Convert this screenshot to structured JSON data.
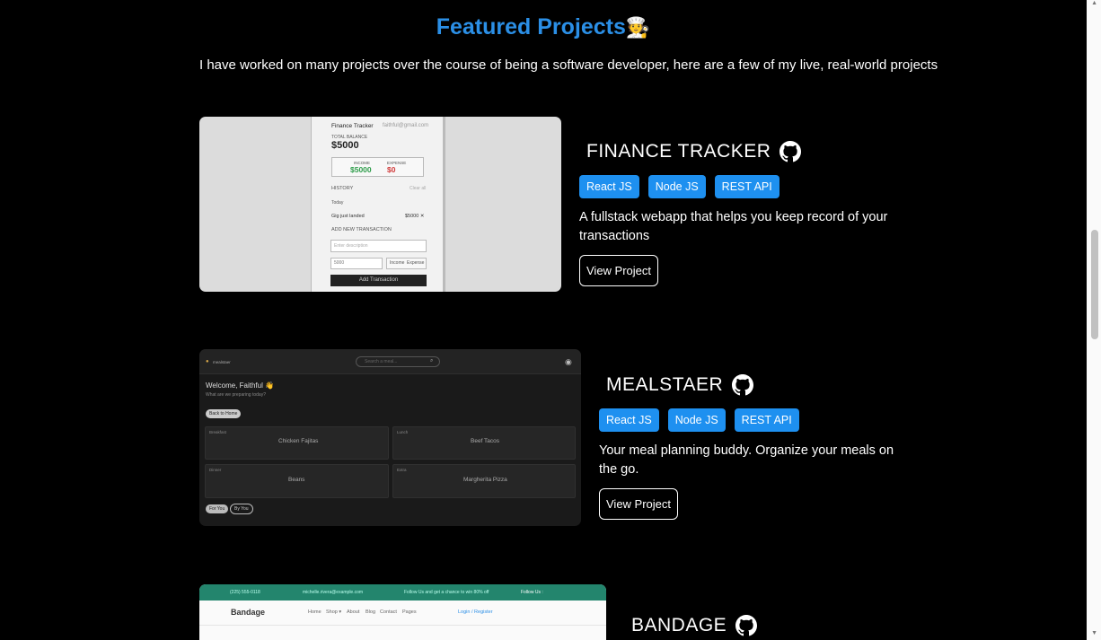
{
  "section": {
    "title": "Featured Projects",
    "title_emoji": "🧑‍🍳",
    "intro": "I have worked on many projects over the course of being a software developer, here are a few of my live, real-world projects"
  },
  "projects": [
    {
      "name": "FINANCE TRACKER",
      "tags": [
        "React JS",
        "Node JS",
        "REST API"
      ],
      "description": "A fullstack webapp that helps you keep record of your transactions",
      "button": "View Project",
      "screenshot": {
        "app_title": "Finance Tracker",
        "email": "faithful@gmail.com",
        "balance_label": "TOTAL BALANCE",
        "balance": "$5000",
        "income_label": "INCOME",
        "income": "$5000",
        "expense_label": "EXPENSE",
        "expense": "$0",
        "history_label": "HISTORY",
        "history_link": "Clear all",
        "today_label": "Today",
        "item_name": "Gig just landed",
        "item_amount": "$5000 ✕",
        "add_label": "ADD NEW TRANSACTION",
        "desc_placeholder": "Enter description",
        "amount_value": "5000",
        "income_btn": "Income",
        "expense_btn": "Expense",
        "submit": "Add Transaction"
      }
    },
    {
      "name": "MEALSTAER",
      "tags": [
        "React JS",
        "Node JS",
        "REST API"
      ],
      "description": "Your meal planning buddy. Organize your meals on the go.",
      "button": "View Project",
      "screenshot": {
        "logo": "mealstaer",
        "search_placeholder": "Search a meal...",
        "welcome": "Welcome, Faithful 👋",
        "subtitle": "What are we preparing today?",
        "pill": "Back to Home",
        "meals": [
          {
            "type": "Breakfast",
            "name": "Chicken Fajitas"
          },
          {
            "type": "Lunch",
            "name": "Beef Tacos"
          },
          {
            "type": "Dinner",
            "name": "Beans"
          },
          {
            "type": "Extra",
            "name": "Margherita Pizza"
          }
        ],
        "btn1": "For You",
        "btn2": "By You"
      }
    },
    {
      "name": "BANDAGE",
      "screenshot": {
        "phone": "(225) 555-0118",
        "email": "michelle.rivera@example.com",
        "promo": "Follow Us and get a chance to win 80% off",
        "follow": "Follow Us :",
        "brand": "Bandage",
        "nav": [
          "Home",
          "Shop ▾",
          "About",
          "Blog",
          "Contact",
          "Pages"
        ],
        "login": "Login / Register"
      }
    }
  ],
  "colors": {
    "title": "#2b8fe6",
    "tag_bg": "#1e90f0",
    "background": "#000000",
    "income": "#2e9c4a",
    "expense": "#d13a3a",
    "bandage_green": "#23856d"
  }
}
